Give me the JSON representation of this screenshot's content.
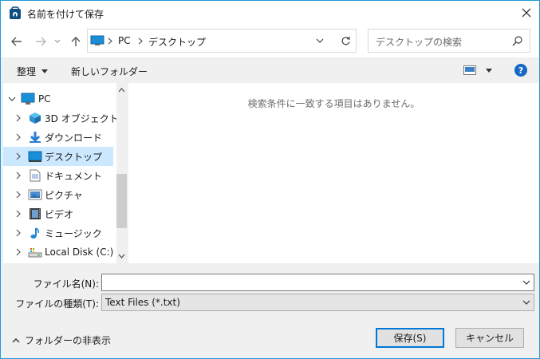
{
  "window": {
    "title": "名前を付けて保存"
  },
  "address_bar": {
    "crumbs": [
      "PC",
      "デスクトップ"
    ]
  },
  "search": {
    "placeholder": "デスクトップの検索"
  },
  "toolbar": {
    "organize_label": "整理",
    "new_folder_label": "新しいフォルダー"
  },
  "nav_tree": {
    "root_label": "PC",
    "items": [
      {
        "label": "3D オブジェクト",
        "icon": "3d-objects-icon"
      },
      {
        "label": "ダウンロード",
        "icon": "download-icon"
      },
      {
        "label": "デスクトップ",
        "icon": "desktop-icon",
        "selected": true
      },
      {
        "label": "ドキュメント",
        "icon": "document-icon"
      },
      {
        "label": "ピクチャ",
        "icon": "pictures-icon"
      },
      {
        "label": "ビデオ",
        "icon": "video-icon"
      },
      {
        "label": "ミュージック",
        "icon": "music-icon"
      },
      {
        "label": "Local Disk (C:)",
        "icon": "drive-icon"
      }
    ]
  },
  "content": {
    "empty_message": "検索条件に一致する項目はありません。"
  },
  "form": {
    "filename_label": "ファイル名(N):",
    "filename_value": "",
    "filetype_label": "ファイルの種類(T):",
    "filetype_value": "Text Files (*.txt)"
  },
  "footer": {
    "hide_folders_label": "フォルダーの非表示",
    "save_label": "保存(S)",
    "cancel_label": "キャンセル"
  },
  "colors": {
    "accent": "#0078d7",
    "selection": "#cce8ff",
    "window_border": "#1f9bd6"
  }
}
